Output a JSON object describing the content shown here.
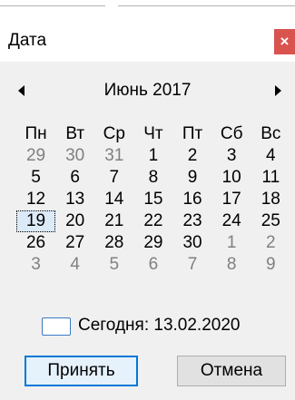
{
  "window": {
    "title": "Дата",
    "close_glyph": "×"
  },
  "calendar": {
    "month_label": "Июнь 2017",
    "weekdays": [
      "Пн",
      "Вт",
      "Ср",
      "Чт",
      "Пт",
      "Сб",
      "Вс"
    ],
    "weeks": [
      [
        {
          "d": "29",
          "m": true
        },
        {
          "d": "30",
          "m": true
        },
        {
          "d": "31",
          "m": true
        },
        {
          "d": "1"
        },
        {
          "d": "2"
        },
        {
          "d": "3"
        },
        {
          "d": "4"
        }
      ],
      [
        {
          "d": "5"
        },
        {
          "d": "6"
        },
        {
          "d": "7"
        },
        {
          "d": "8"
        },
        {
          "d": "9"
        },
        {
          "d": "10"
        },
        {
          "d": "11"
        }
      ],
      [
        {
          "d": "12"
        },
        {
          "d": "13"
        },
        {
          "d": "14"
        },
        {
          "d": "15"
        },
        {
          "d": "16"
        },
        {
          "d": "17"
        },
        {
          "d": "18"
        }
      ],
      [
        {
          "d": "19",
          "sel": true
        },
        {
          "d": "20"
        },
        {
          "d": "21"
        },
        {
          "d": "22"
        },
        {
          "d": "23"
        },
        {
          "d": "24"
        },
        {
          "d": "25"
        }
      ],
      [
        {
          "d": "26"
        },
        {
          "d": "27"
        },
        {
          "d": "28"
        },
        {
          "d": "29"
        },
        {
          "d": "30"
        },
        {
          "d": "1",
          "m": true
        },
        {
          "d": "2",
          "m": true
        }
      ],
      [
        {
          "d": "3",
          "m": true
        },
        {
          "d": "4",
          "m": true
        },
        {
          "d": "5",
          "m": true
        },
        {
          "d": "6",
          "m": true
        },
        {
          "d": "7",
          "m": true
        },
        {
          "d": "8",
          "m": true
        },
        {
          "d": "9",
          "m": true
        }
      ]
    ],
    "today_label": "Сегодня: 13.02.2020"
  },
  "buttons": {
    "accept": "Принять",
    "cancel": "Отмена"
  },
  "colors": {
    "close_bg": "#d9534f",
    "primary_border": "#0078d7",
    "muted_text": "#808080"
  }
}
